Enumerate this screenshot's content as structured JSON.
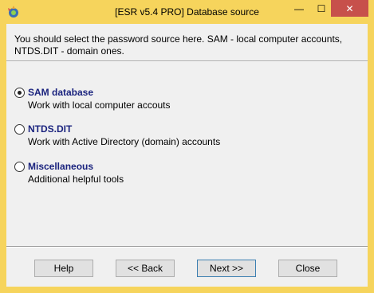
{
  "window": {
    "title": "[ESR v5.4 PRO]  Database source",
    "controls": {
      "minimize": "—",
      "maximize": "☐",
      "close": "✕"
    }
  },
  "intro_text": "You should select the password source here. SAM - local computer accounts, NTDS.DIT - domain ones.",
  "options": [
    {
      "title": "SAM database",
      "description": "Work with local computer accouts",
      "selected": true
    },
    {
      "title": "NTDS.DIT",
      "description": "Work with Active Directory (domain) accounts",
      "selected": false
    },
    {
      "title": "Miscellaneous",
      "description": "Additional helpful tools",
      "selected": false
    }
  ],
  "buttons": {
    "help": "Help",
    "back": "<< Back",
    "next": "Next >>",
    "close": "Close"
  },
  "colors": {
    "frame": "#f6d45c",
    "close_button": "#c7504b",
    "option_title": "#1a237e",
    "client_bg": "#f0f0f0"
  },
  "icons": {
    "app": "app-icon"
  }
}
